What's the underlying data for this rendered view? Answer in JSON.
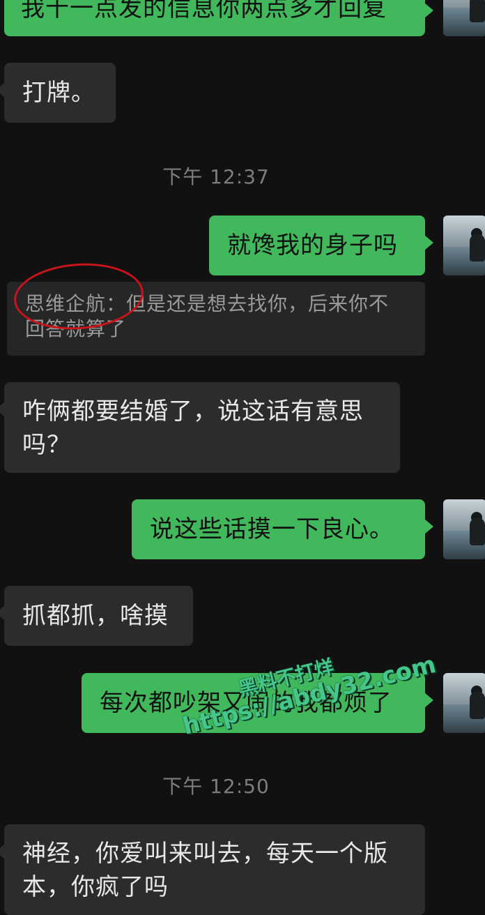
{
  "messages": [
    {
      "side": "out",
      "text": "我十一点发的信息你两点多才回复"
    },
    {
      "side": "in",
      "text": "打牌。"
    },
    {
      "type": "time",
      "text": "下午 12:37"
    },
    {
      "side": "out",
      "text": "就馋我的身子吗"
    },
    {
      "type": "quote",
      "text": "思维企航：但是还是想去找你，后来你不回答就算了"
    },
    {
      "side": "in",
      "text": "咋俩都要结婚了，说这话有意思吗？"
    },
    {
      "side": "out",
      "text": "说这些话摸一下良心。"
    },
    {
      "side": "in",
      "text": "抓都抓，啥摸"
    },
    {
      "side": "out",
      "text": "每次都吵架又闹的我都烦了"
    },
    {
      "type": "time",
      "text": "下午 12:50"
    },
    {
      "side": "in",
      "text": "神经，你爱叫来叫去，每天一个版本，你疯了吗"
    }
  ],
  "watermark": {
    "line1": "黑料不打烊",
    "line2": "https://abdy32.com"
  },
  "colors": {
    "background": "#111111",
    "outgoing_bubble": "#42b85c",
    "incoming_bubble": "#2c2c2c",
    "annotation_circle": "#c8141c"
  }
}
